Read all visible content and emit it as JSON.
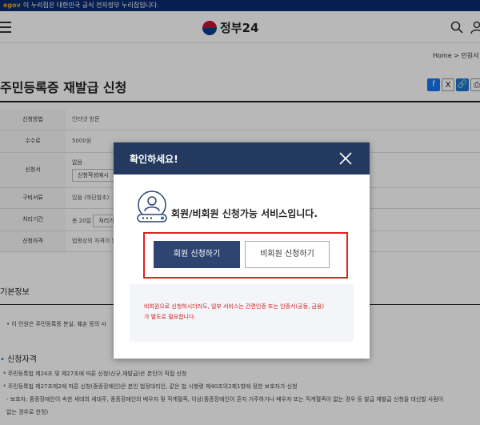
{
  "topbar": {
    "mark": "egov",
    "text": "이 누리집은 대한민국 공식 전자정부 누리집입니다."
  },
  "header": {
    "logo_text": "정부24",
    "menu_icon": "hamburger-icon",
    "search_icon": "search-icon",
    "user_icon": "user-icon"
  },
  "breadcrumb": {
    "home": "Home",
    "sep": ">",
    "current": "민원서"
  },
  "page": {
    "title": "주민등록증 재발급 신청"
  },
  "share": {
    "fb": "f",
    "x": "X",
    "link": "🔗",
    "print": "⎙"
  },
  "info_table": {
    "rows": [
      {
        "key": "신청방법",
        "value": "인터넷 방문"
      },
      {
        "key": "수수료",
        "value": "5000원"
      },
      {
        "key": "신청서",
        "value": "없음",
        "button": "신청작성예시"
      },
      {
        "key": "구비서류",
        "value": "있음 (하단참조)"
      },
      {
        "key": "처리기간",
        "value": "총 20일",
        "button": "처리기"
      },
      {
        "key": "신청자격",
        "value": "법령상의 자격이 있"
      }
    ]
  },
  "sections": {
    "basic_info": "기본정보",
    "basic_bullet": "• 이 민원은 주민등록증 분실, 훼손 등의 사",
    "qualification": "신청자격",
    "q1": "* 주민등록법 제24조 및 제27조에 따른 신청(신규,재발급)은 본인이 직접 신청",
    "q2": "* 주민등록법 제27조제2에 따른 신청(중증장애인)은 본인 법정대리인, 같은 법 시행령 제40조의2제1항에 정한 보호자가 신청",
    "q3": "- 보호자: 중증장애인이 속한 세대의 세대주, 중증장애인의 배우자 및 직계혈족, 이상(중증장애인이 혼자 거주하거나 배우자 또는 직계혈족이 없는 경우 등 발급 재발급 신청을 대신할 사람이",
    "q4": "없는 경우로 한정)"
  },
  "modal": {
    "title": "확인하세요!",
    "message": "회원/비회원 신청가능 서비스입니다.",
    "member_button": "회원 신청하기",
    "nonmember_button": "비회원 신청하기",
    "notice_line1": "비회원으로 신청하시더라도, 일부 서비스는 간편인증 또는 인증서(공동, 금융)",
    "notice_line2": "가 별도로 필요합니다."
  },
  "colors": {
    "modal_header": "#24395e",
    "member_button": "#2d4570",
    "highlight": "#e52020",
    "notice_text": "#d0201f",
    "topbar": "#0b2a6f"
  }
}
